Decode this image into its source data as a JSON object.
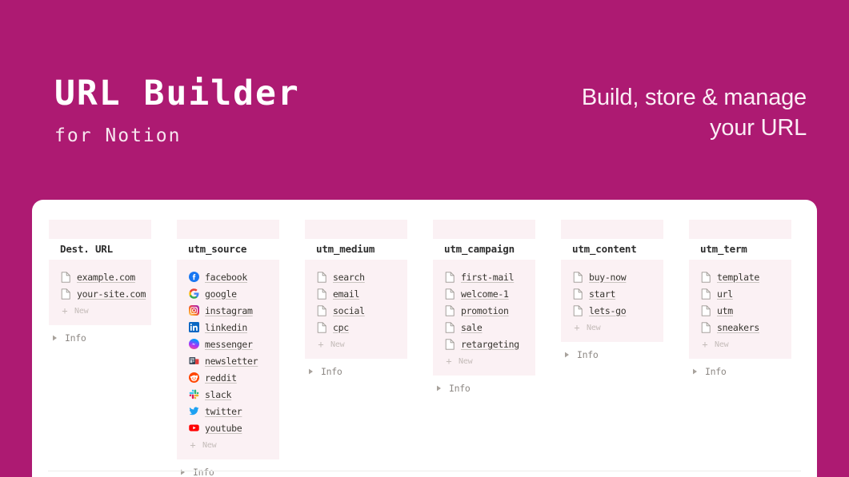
{
  "hero": {
    "title": "URL Builder",
    "subtitle": "for Notion",
    "tagline_line1": "Build, store & manage",
    "tagline_line2": "your URL",
    "background_color": "#ad1a72",
    "title_color": "#ffffff"
  },
  "board": {
    "panel_color": "#fbf1f4",
    "card_color": "#ffffff",
    "new_label": "+ New",
    "new_plus": "+",
    "new_text": "New",
    "info_label": "Info",
    "columns": [
      {
        "title": "Dest. URL",
        "has_info": true,
        "items": [
          {
            "icon": "page-icon",
            "label": "example.com"
          },
          {
            "icon": "page-icon",
            "label": "your-site.com"
          }
        ]
      },
      {
        "title": "utm_source",
        "has_info": false,
        "items": [
          {
            "icon": "facebook-icon",
            "label": "facebook"
          },
          {
            "icon": "google-icon",
            "label": "google"
          },
          {
            "icon": "instagram-icon",
            "label": "instagram"
          },
          {
            "icon": "linkedin-icon",
            "label": "linkedin"
          },
          {
            "icon": "messenger-icon",
            "label": "messenger"
          },
          {
            "icon": "newsletter-icon",
            "label": "newsletter"
          },
          {
            "icon": "reddit-icon",
            "label": "reddit"
          },
          {
            "icon": "slack-icon",
            "label": "slack"
          },
          {
            "icon": "twitter-icon",
            "label": "twitter"
          },
          {
            "icon": "youtube-icon",
            "label": "youtube"
          }
        ]
      },
      {
        "title": "utm_medium",
        "has_info": true,
        "items": [
          {
            "icon": "page-icon",
            "label": "search"
          },
          {
            "icon": "page-icon",
            "label": "email"
          },
          {
            "icon": "page-icon",
            "label": "social"
          },
          {
            "icon": "page-icon",
            "label": "cpc"
          }
        ]
      },
      {
        "title": "utm_campaign",
        "has_info": true,
        "items": [
          {
            "icon": "page-icon",
            "label": "first-mail"
          },
          {
            "icon": "page-icon",
            "label": "welcome-1"
          },
          {
            "icon": "page-icon",
            "label": "promotion"
          },
          {
            "icon": "page-icon",
            "label": "sale"
          },
          {
            "icon": "page-icon",
            "label": "retargeting"
          }
        ]
      },
      {
        "title": "utm_content",
        "has_info": true,
        "items": [
          {
            "icon": "page-icon",
            "label": "buy-now"
          },
          {
            "icon": "page-icon",
            "label": "start"
          },
          {
            "icon": "page-icon",
            "label": "lets-go"
          }
        ]
      },
      {
        "title": "utm_term",
        "has_info": true,
        "items": [
          {
            "icon": "page-icon",
            "label": "template"
          },
          {
            "icon": "page-icon",
            "label": "url"
          },
          {
            "icon": "page-icon",
            "label": "utm"
          },
          {
            "icon": "page-icon",
            "label": "sneakers"
          }
        ]
      }
    ]
  }
}
